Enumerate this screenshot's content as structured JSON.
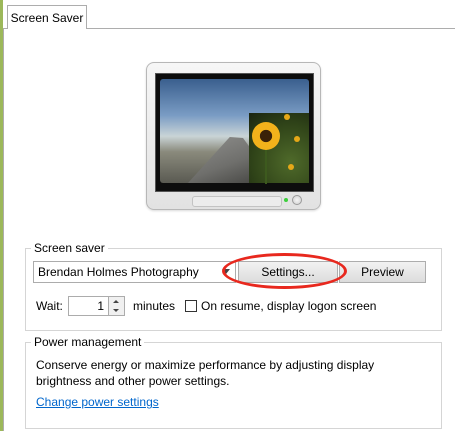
{
  "tab": {
    "label": "Screen Saver"
  },
  "screen_saver_group": {
    "label": "Screen saver",
    "selected": "Brendan Holmes Photography",
    "settings_button": "Settings...",
    "preview_button": "Preview",
    "wait_label": "Wait:",
    "wait_value": "1",
    "minutes_label": "minutes",
    "resume_label": "On resume, display logon screen",
    "resume_checked": false
  },
  "power_group": {
    "label": "Power management",
    "description": "Conserve energy or maximize performance by adjusting display brightness and other power settings.",
    "link": "Change power settings"
  },
  "colors": {
    "highlight": "#e8281e",
    "link": "#0066cc",
    "accent_strip": "#9cb85a"
  }
}
